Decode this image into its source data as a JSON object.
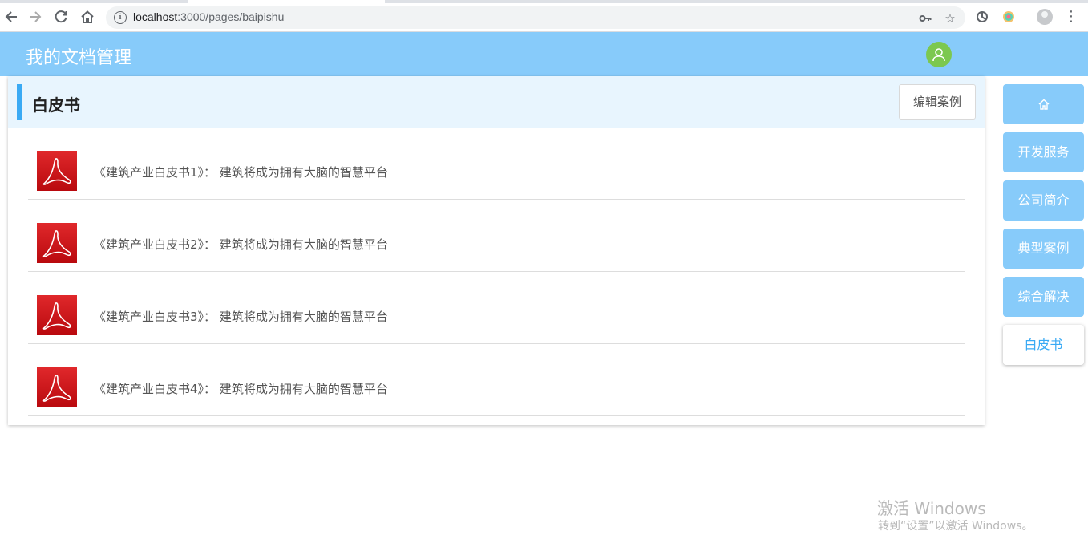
{
  "browser": {
    "url_host": "localhost",
    "url_path": ":3000/pages/baipishu",
    "icons": [
      "back-arrow-icon",
      "forward-arrow-icon",
      "reload-icon",
      "home-icon",
      "info-icon",
      "key-icon",
      "star-icon",
      "extension-icon",
      "extension-color-icon",
      "profile-icon",
      "menu-icon"
    ]
  },
  "header": {
    "title": "我的文档管理",
    "avatar_icon": "user-icon",
    "background": "#87cbfa",
    "avatar_color": "#7cc84f"
  },
  "panel": {
    "title": "白皮书",
    "edit_button": "编辑案例",
    "accent": "#3aaaf4",
    "documents": [
      {
        "icon": "pdf-icon",
        "title": "《建筑产业白皮书1》： 建筑将成为拥有大脑的智慧平台"
      },
      {
        "icon": "pdf-icon",
        "title": "《建筑产业白皮书2》： 建筑将成为拥有大脑的智慧平台"
      },
      {
        "icon": "pdf-icon",
        "title": "《建筑产业白皮书3》： 建筑将成为拥有大脑的智慧平台"
      },
      {
        "icon": "pdf-icon",
        "title": "《建筑产业白皮书4》： 建筑将成为拥有大脑的智慧平台"
      }
    ]
  },
  "side_nav": {
    "items": [
      {
        "icon": "home-icon",
        "label": ""
      },
      {
        "label": "开发服务"
      },
      {
        "label": "公司简介"
      },
      {
        "label": "典型案例"
      },
      {
        "label": "综合解决"
      },
      {
        "label": "白皮书",
        "active": true
      }
    ]
  },
  "watermark": {
    "line1": "激活 Windows",
    "line2": "转到“设置”以激活 Windows。"
  }
}
